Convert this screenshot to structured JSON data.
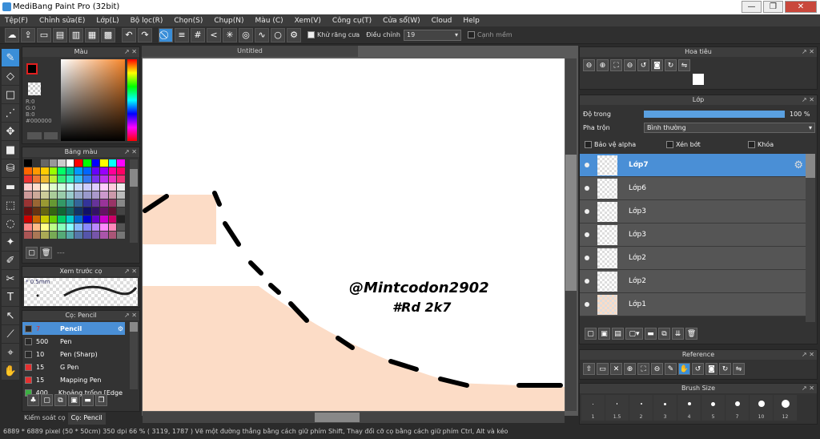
{
  "app": {
    "title": "MediBang Paint Pro (32bit)"
  },
  "window": {
    "min": "—",
    "max": "❐",
    "close": "✕"
  },
  "menu": [
    "Tệp(F)",
    "Chỉnh sửa(E)",
    "Lớp(L)",
    "Bộ lọc(R)",
    "Chọn(S)",
    "Chụp(N)",
    "Màu (C)",
    "Xem(V)",
    "Công cụ(T)",
    "Cửa sổ(W)",
    "Cloud",
    "Help"
  ],
  "toolbar": {
    "antialias_label": "Khử răng cưa",
    "adjust_label": "Điều chỉnh",
    "adjust_value": "19",
    "edge_label": "Cạnh mềm"
  },
  "color_panel": {
    "title": "Màu",
    "r": "R:0",
    "g": "G:0",
    "b": "B:0",
    "hex": "#000000"
  },
  "palette_panel": {
    "title": "Bảng màu",
    "footer": "---"
  },
  "preview_panel": {
    "title": "Xem trước cọ",
    "size": "* 0.5mm"
  },
  "brush_panel": {
    "title": "Cọ: Pencil",
    "items": [
      {
        "size": "7",
        "name": "Pencil",
        "color": "#2a2a2a"
      },
      {
        "size": "500",
        "name": "Pen",
        "color": "#2a2a2a"
      },
      {
        "size": "10",
        "name": "Pen (Sharp)",
        "color": "#2a2a2a"
      },
      {
        "size": "15",
        "name": "G Pen",
        "color": "#e53030"
      },
      {
        "size": "15",
        "name": "Mapping Pen",
        "color": "#e53030"
      },
      {
        "size": "400",
        "name": "Khoảng trống [Edge I",
        "color": "#3cb043"
      }
    ]
  },
  "bottom_tabs": [
    "Kiểm soát cọ",
    "Cọ: Pencil"
  ],
  "canvas": {
    "tab": "Untitled",
    "watermark_line1": "@Mintcodon2902",
    "watermark_line2": "#Rd 2k7"
  },
  "navigator": {
    "title": "Hoa tiêu"
  },
  "layer_panel": {
    "title": "Lớp",
    "opacity_label": "Độ trong",
    "opacity_value": "100 %",
    "opacity": 1.0,
    "blend_label": "Pha trộn",
    "blend_value": "Bình thường",
    "protect_alpha": "Bảo vệ alpha",
    "clipping": "Xén bớt",
    "lock": "Khóa",
    "layers": [
      "Lớp7",
      "Lớp6",
      "Lớp3",
      "Lớp3",
      "Lớp2",
      "Lớp2",
      "Lớp1"
    ]
  },
  "reference_panel": {
    "title": "Reference"
  },
  "brushsize_panel": {
    "title": "Brush Size",
    "sizes": [
      "1",
      "1.5",
      "2",
      "3",
      "4",
      "5",
      "7",
      "10",
      "12"
    ]
  },
  "status": {
    "text": "6889 * 6889 pixel   (50 * 50cm)   350 dpi   66 %   ( 3119, 1787 )   Vẽ một đường thẳng bằng cách giữ phím Shift, Thay đổi cỡ cọ bằng cách giữ phím Ctrl, Alt và kéo"
  }
}
